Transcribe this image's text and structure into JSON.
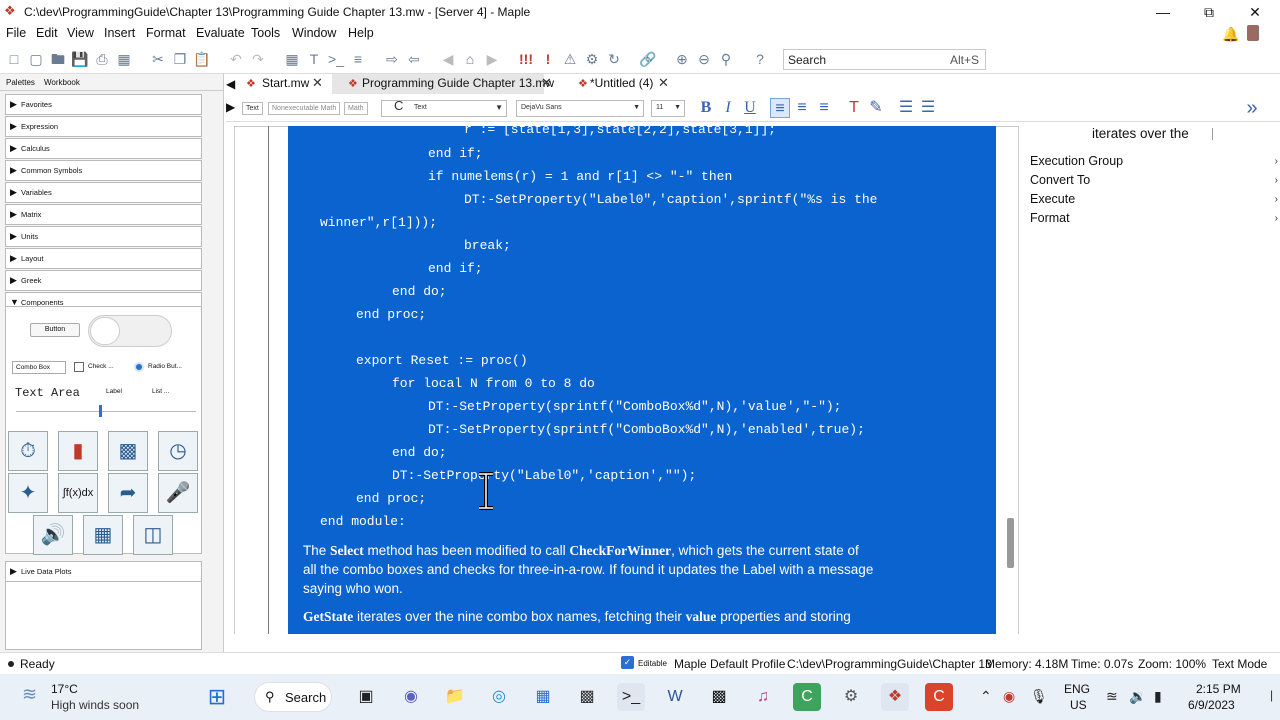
{
  "window": {
    "title": "C:\\dev\\ProgrammingGuide\\Chapter 13\\Programming Guide Chapter 13.mw - [Server 4] - Maple",
    "minimize": "—",
    "restore": "⧉",
    "close": "✕"
  },
  "menu": [
    "File",
    "Edit",
    "View",
    "Insert",
    "Format",
    "Evaluate",
    "Tools",
    "Window",
    "Help"
  ],
  "search": {
    "placeholder": "Search",
    "shortcut": "Alt+S"
  },
  "palettes": {
    "tabs": [
      "Palettes",
      "Workbook"
    ],
    "items": [
      "Favorites",
      "Expression",
      "Calculus",
      "Common Symbols",
      "Variables",
      "Matrix",
      "Units",
      "Layout",
      "Greek"
    ],
    "components_label": "Components",
    "components": {
      "button": "Button",
      "combo": "Combo Box",
      "check": "Check ...",
      "radio": "Radio But...",
      "text_area": "Text Area",
      "label": "Label",
      "list": "List ..."
    },
    "live_data_plots": "Live Data Plots"
  },
  "doc_tabs": [
    {
      "label": "Start.mw"
    },
    {
      "label": "Programming Guide Chapter 13.mw"
    },
    {
      "label": "*Untitled (4)"
    }
  ],
  "format_bar": {
    "text_btn": "Text",
    "nonexec_btn": "Nonexecutable Math",
    "math_btn": "Math",
    "style": "Text",
    "font": "DejaVu Sans",
    "size": "11"
  },
  "code_lines": [
    "r := [state[1,3],state[2,2],state[3,1]];",
    "end if;",
    "if numelems(r) = 1 and r[1] <> \"-\" then",
    "DT:-SetProperty(\"Label0\",'caption',sprintf(\"%s is the",
    "winner\",r[1]));",
    "break;",
    "end if;",
    "end do;",
    "end proc;",
    "export Reset := proc()",
    "for local N from 0 to 8 do",
    "DT:-SetProperty(sprintf(\"ComboBox%d\",N),'value',\"-\");",
    "DT:-SetProperty(sprintf(\"ComboBox%d\",N),'enabled',true);",
    "end do;",
    "DT:-SetProperty(\"Label0\",'caption',\"\");",
    "end proc;",
    "end module:"
  ],
  "prose": {
    "p1_a": "The ",
    "p1_b": "Select",
    "p1_c": " method has been modified to call ",
    "p1_d": "CheckForWinner",
    "p1_e": ", which gets the current state of",
    "p1_line2": "all the combo boxes and checks for three-in-a-row.  If found it updates the Label with a message",
    "p1_line3": "saying who won.",
    "p2_a": "GetState",
    "p2_b": " iterates over the nine combo box names, fetching their ",
    "p2_c": "value",
    "p2_d": " properties and storing"
  },
  "right_panel": {
    "header": "iterates over the",
    "items": [
      "Execution Group",
      "Convert To",
      "Execute",
      "Format"
    ]
  },
  "status": {
    "ready": "Ready",
    "editable": "Editable",
    "profile": "Maple Default Profile",
    "path": "C:\\dev\\ProgrammingGuide\\Chapter 13",
    "memory": "Memory: 4.18M",
    "time": "Time: 0.07s",
    "zoom": "Zoom: 100%",
    "mode": "Text Mode"
  },
  "taskbar": {
    "weather_temp": "17°C",
    "weather_desc": "High winds soon",
    "search": "Search",
    "lang1": "ENG",
    "lang2": "US",
    "time": "2:15 PM",
    "date": "6/9/2023"
  },
  "colors": {
    "selection_blue": "#0a63cf",
    "maple_red": "#c0392b",
    "icon_blue": "#3e63b2"
  }
}
